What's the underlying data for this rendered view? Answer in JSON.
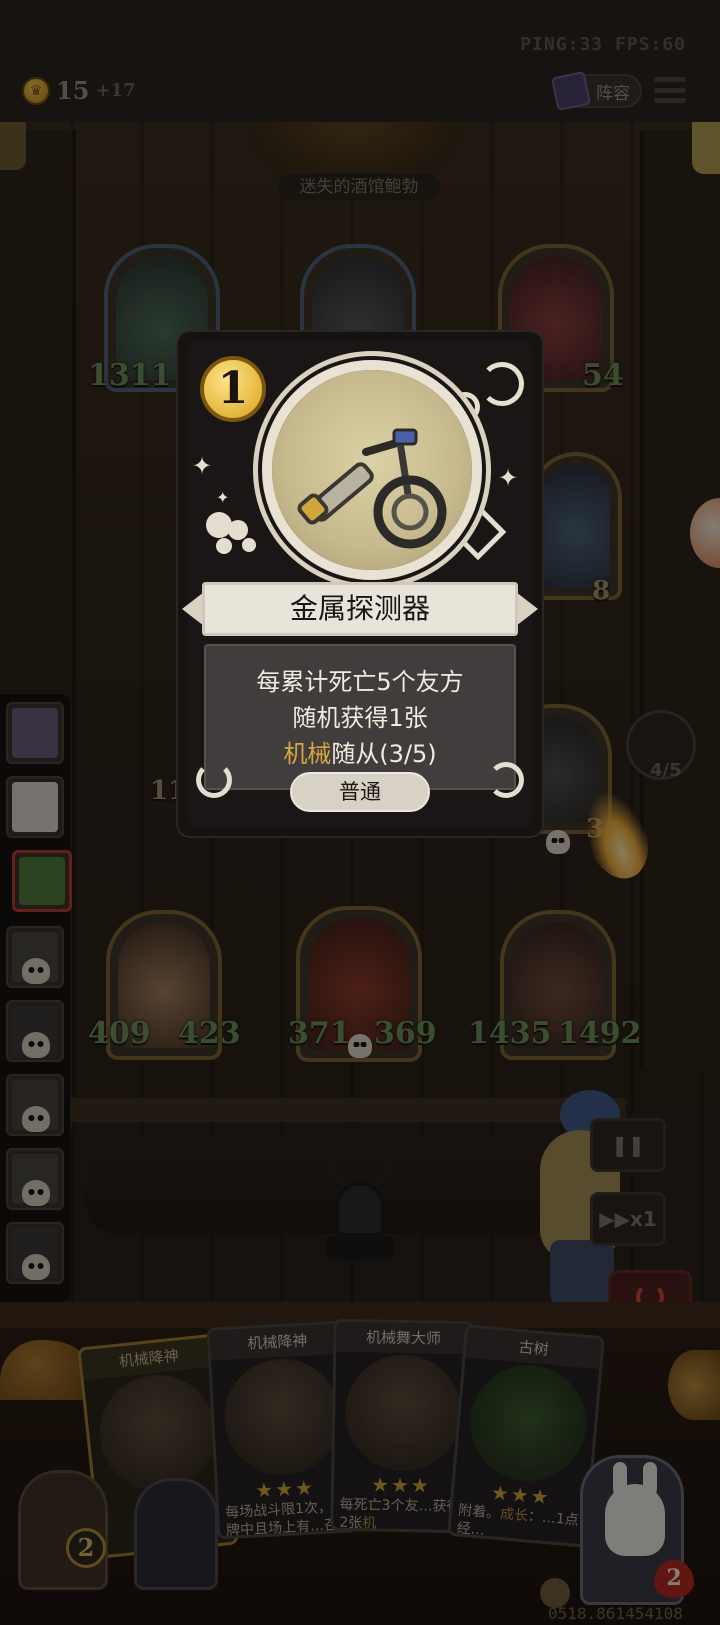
{
  "top_bar": {
    "ping_text": "PING:33  FPS:60",
    "gold": "15",
    "gold_bonus": "+17",
    "lineup_label": "阵容"
  },
  "tavern": {
    "name": "迷失的酒馆鲍勃"
  },
  "board_top": [
    {
      "attack": "1311",
      "health": ""
    },
    {
      "attack": "",
      "health": ""
    },
    {
      "attack": "",
      "health": "54"
    },
    {
      "attack": "",
      "health": "8"
    }
  ],
  "board_mid": [
    {
      "attack": "11",
      "health": ""
    },
    {
      "attack": "",
      "health": "3"
    }
  ],
  "board_bottom": [
    {
      "attack": "409",
      "health": "423"
    },
    {
      "attack": "371",
      "health": "369"
    },
    {
      "attack": "1435",
      "health": "1492"
    }
  ],
  "quest_progress": "4/5",
  "speed_label": "▶▶x1",
  "item_card": {
    "cost": "1",
    "title": "金属探测器",
    "desc_line1": "每累计死亡5个友方",
    "desc_line2": "随机获得1张",
    "desc_line3_highlight": "机械",
    "desc_line3_rest": "随从(3/5)",
    "rarity": "普通"
  },
  "hand_cards": [
    {
      "title": "机械降神",
      "stars": "★★★",
      "desc": ""
    },
    {
      "title": "机械降神",
      "stars": "★★★",
      "desc": "每场战斗限1次，手牌中且场上有…召唤本随从的…"
    },
    {
      "title": "机械舞大师",
      "stars": "★★★",
      "desc_pre": "每死亡3个友…获得2张",
      "desc_hl": "机"
    },
    {
      "title": "古树",
      "stars": "★★★",
      "desc_pre": "附着。",
      "desc_hl": "成长",
      "desc_post": "：…1点经…"
    }
  ],
  "tavern_tier": "2",
  "hero_health": "2",
  "bottom_id": "0518.861454108",
  "colors": {
    "gold_coin": "#f6cc5a",
    "highlight": "#d6a741",
    "stat_green": "#6e8f57",
    "active_player_border": "#b73a2f"
  }
}
